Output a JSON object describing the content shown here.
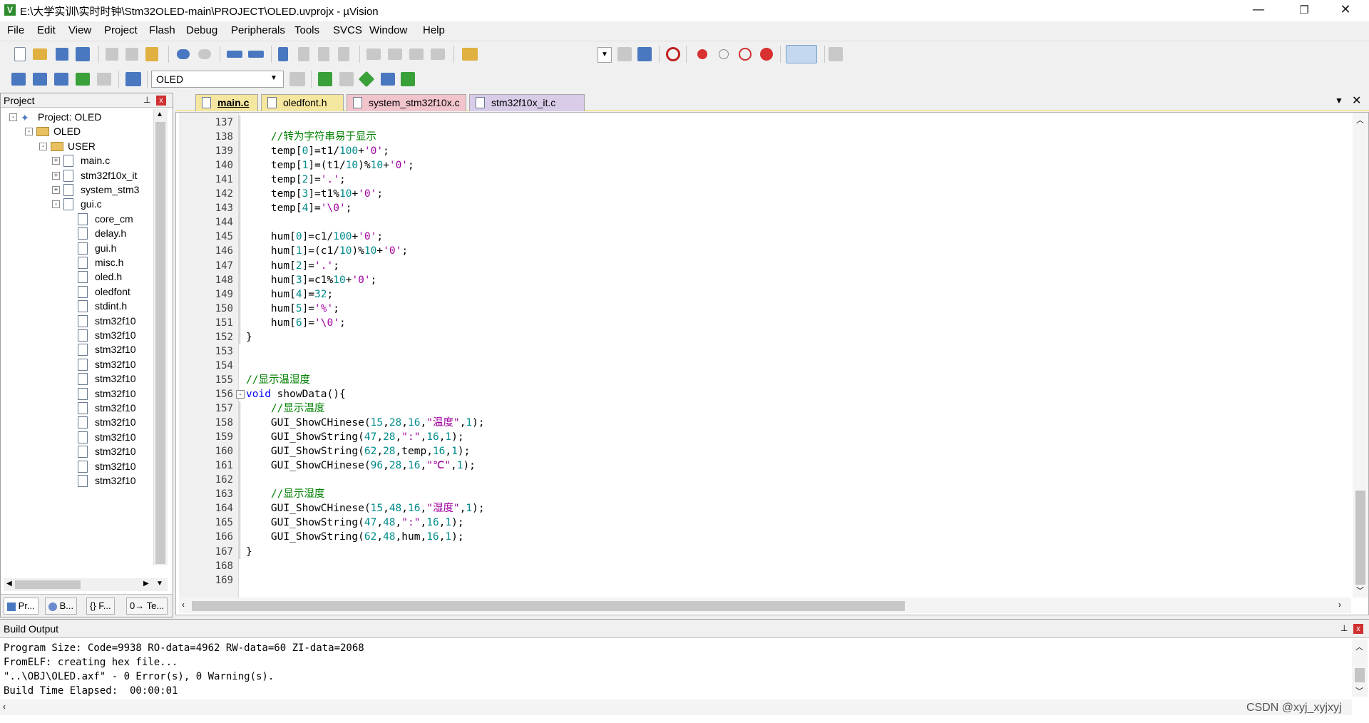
{
  "window": {
    "title": "E:\\大学实训\\实时时钟\\Stm32OLED-main\\PROJECT\\OLED.uvprojx - µVision",
    "minimize": "—",
    "restore": "❐",
    "close": "✕"
  },
  "menu": [
    "File",
    "Edit",
    "View",
    "Project",
    "Flash",
    "Debug",
    "Peripherals",
    "Tools",
    "SVCS",
    "Window",
    "Help"
  ],
  "toolbar2": {
    "target_select": "OLED"
  },
  "project_panel": {
    "title": "Project",
    "pin": "📌",
    "close": "x",
    "tree": [
      {
        "label": "Project: OLED",
        "level": 0,
        "toggle": "-",
        "icon": "project-icon"
      },
      {
        "label": "OLED",
        "level": 1,
        "toggle": "-",
        "icon": "target-folder-icon"
      },
      {
        "label": "USER",
        "level": 2,
        "toggle": "-",
        "icon": "folder-icon"
      },
      {
        "label": "main.c",
        "level": 3,
        "toggle": "+",
        "icon": "file-icon"
      },
      {
        "label": "stm32f10x_it",
        "level": 3,
        "toggle": "+",
        "icon": "file-icon"
      },
      {
        "label": "system_stm3",
        "level": 3,
        "toggle": "+",
        "icon": "file-icon"
      },
      {
        "label": "gui.c",
        "level": 3,
        "toggle": "-",
        "icon": "file-icon"
      },
      {
        "label": "core_cm",
        "level": 4,
        "toggle": "",
        "icon": "file-icon"
      },
      {
        "label": "delay.h",
        "level": 4,
        "toggle": "",
        "icon": "file-icon"
      },
      {
        "label": "gui.h",
        "level": 4,
        "toggle": "",
        "icon": "file-icon"
      },
      {
        "label": "misc.h",
        "level": 4,
        "toggle": "",
        "icon": "file-icon"
      },
      {
        "label": "oled.h",
        "level": 4,
        "toggle": "",
        "icon": "file-icon"
      },
      {
        "label": "oledfont",
        "level": 4,
        "toggle": "",
        "icon": "file-icon"
      },
      {
        "label": "stdint.h",
        "level": 4,
        "toggle": "",
        "icon": "file-icon"
      },
      {
        "label": "stm32f10",
        "level": 4,
        "toggle": "",
        "icon": "file-icon"
      },
      {
        "label": "stm32f10",
        "level": 4,
        "toggle": "",
        "icon": "file-icon"
      },
      {
        "label": "stm32f10",
        "level": 4,
        "toggle": "",
        "icon": "file-icon"
      },
      {
        "label": "stm32f10",
        "level": 4,
        "toggle": "",
        "icon": "file-icon"
      },
      {
        "label": "stm32f10",
        "level": 4,
        "toggle": "",
        "icon": "file-icon"
      },
      {
        "label": "stm32f10",
        "level": 4,
        "toggle": "",
        "icon": "file-icon"
      },
      {
        "label": "stm32f10",
        "level": 4,
        "toggle": "",
        "icon": "file-icon"
      },
      {
        "label": "stm32f10",
        "level": 4,
        "toggle": "",
        "icon": "file-icon"
      },
      {
        "label": "stm32f10",
        "level": 4,
        "toggle": "",
        "icon": "file-icon"
      },
      {
        "label": "stm32f10",
        "level": 4,
        "toggle": "",
        "icon": "file-icon"
      },
      {
        "label": "stm32f10",
        "level": 4,
        "toggle": "",
        "icon": "file-icon"
      },
      {
        "label": "stm32f10",
        "level": 4,
        "toggle": "",
        "icon": "file-icon"
      }
    ],
    "tabs": [
      "Pr...",
      "B...",
      "{} F...",
      "0→ Te..."
    ]
  },
  "editor": {
    "tabs": [
      {
        "label": "main.c",
        "active": true,
        "color": "#f5e6a0"
      },
      {
        "label": "oledfont.h",
        "active": false,
        "color": "#f5e6a0"
      },
      {
        "label": "system_stm32f10x.c",
        "active": false,
        "color": "#f2c4cc"
      },
      {
        "label": "stm32f10x_it.c",
        "active": false,
        "color": "#d8cce8"
      }
    ],
    "tab_menu": "▼",
    "tab_close": "✕",
    "lines": [
      {
        "n": "137",
        "code": ""
      },
      {
        "n": "138",
        "code": "    //转为字符串易于显示"
      },
      {
        "n": "139",
        "code": "    temp[0]=t1/100+'0';"
      },
      {
        "n": "140",
        "code": "    temp[1]=(t1/10)%10+'0';"
      },
      {
        "n": "141",
        "code": "    temp[2]='.';"
      },
      {
        "n": "142",
        "code": "    temp[3]=t1%10+'0';"
      },
      {
        "n": "143",
        "code": "    temp[4]='\\0';"
      },
      {
        "n": "144",
        "code": ""
      },
      {
        "n": "145",
        "code": "    hum[0]=c1/100+'0';"
      },
      {
        "n": "146",
        "code": "    hum[1]=(c1/10)%10+'0';"
      },
      {
        "n": "147",
        "code": "    hum[2]='.';"
      },
      {
        "n": "148",
        "code": "    hum[3]=c1%10+'0';"
      },
      {
        "n": "149",
        "code": "    hum[4]=32;"
      },
      {
        "n": "150",
        "code": "    hum[5]='%';"
      },
      {
        "n": "151",
        "code": "    hum[6]='\\0';"
      },
      {
        "n": "152",
        "code": "}"
      },
      {
        "n": "153",
        "code": ""
      },
      {
        "n": "154",
        "code": ""
      },
      {
        "n": "155",
        "code": "//显示温湿度"
      },
      {
        "n": "156",
        "code": "void showData(){"
      },
      {
        "n": "157",
        "code": "    //显示温度"
      },
      {
        "n": "158",
        "code": "    GUI_ShowCHinese(15,28,16,\"温度\",1);"
      },
      {
        "n": "159",
        "code": "    GUI_ShowString(47,28,\":\",16,1);"
      },
      {
        "n": "160",
        "code": "    GUI_ShowString(62,28,temp,16,1);"
      },
      {
        "n": "161",
        "code": "    GUI_ShowCHinese(96,28,16,\"℃\",1);"
      },
      {
        "n": "162",
        "code": ""
      },
      {
        "n": "163",
        "code": "    //显示湿度"
      },
      {
        "n": "164",
        "code": "    GUI_ShowCHinese(15,48,16,\"湿度\",1);"
      },
      {
        "n": "165",
        "code": "    GUI_ShowString(47,48,\":\",16,1);"
      },
      {
        "n": "166",
        "code": "    GUI_ShowString(62,48,hum,16,1);"
      },
      {
        "n": "167",
        "code": "}"
      },
      {
        "n": "168",
        "code": ""
      },
      {
        "n": "169",
        "code": ""
      }
    ],
    "fold_marker": "-"
  },
  "build_output": {
    "title": "Build Output",
    "lines": [
      "Program Size: Code=9938 RO-data=4962 RW-data=60 ZI-data=2068",
      "FromELF: creating hex file...",
      "\"..\\OBJ\\OLED.axf\" - 0 Error(s), 0 Warning(s).",
      "Build Time Elapsed:  00:00:01"
    ]
  },
  "watermark": "CSDN @xyj_xyjxyj"
}
